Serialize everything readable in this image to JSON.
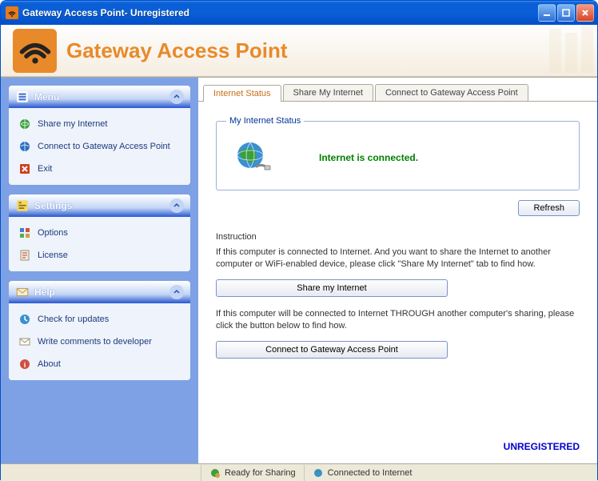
{
  "window": {
    "title": "Gateway Access Point- Unregistered"
  },
  "header": {
    "title": "Gateway Access Point"
  },
  "sidebar": {
    "menu": {
      "title": "Menu",
      "items": [
        {
          "label": "Share my Internet"
        },
        {
          "label": "Connect to Gateway Access Point"
        },
        {
          "label": "Exit"
        }
      ]
    },
    "settings": {
      "title": "Settings",
      "items": [
        {
          "label": "Options"
        },
        {
          "label": "License"
        }
      ]
    },
    "help": {
      "title": "Help",
      "items": [
        {
          "label": "Check for updates"
        },
        {
          "label": "Write comments to developer"
        },
        {
          "label": "About"
        }
      ]
    }
  },
  "tabs": [
    {
      "label": "Internet Status",
      "active": true
    },
    {
      "label": "Share My Internet",
      "active": false
    },
    {
      "label": "Connect to Gateway Access Point",
      "active": false
    }
  ],
  "status": {
    "legend": "My Internet Status",
    "text": "Internet is connected.",
    "refresh": "Refresh"
  },
  "instruction": {
    "heading": "Instruction",
    "p1": "If this computer is connected to Internet. And you want to share the Internet to another computer or WiFi-enabled device, please click \"Share My Internet\" tab to find how.",
    "btn1": "Share my Internet",
    "p2": "If this computer will be connected to Internet THROUGH another computer's sharing, please click the button below to find how.",
    "btn2": "Connect to Gateway Access Point"
  },
  "footer": {
    "unregistered": "UNREGISTERED"
  },
  "statusbar": {
    "ready": "Ready for Sharing",
    "connected": "Connected to Internet"
  }
}
